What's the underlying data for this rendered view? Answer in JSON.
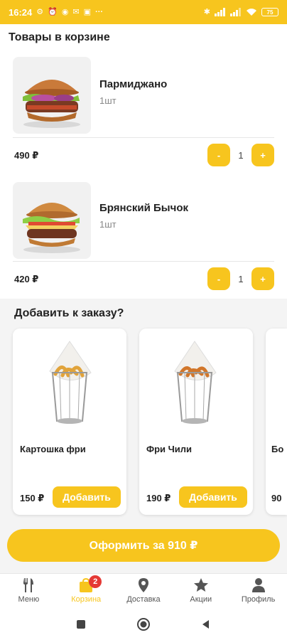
{
  "status_bar": {
    "time": "16:24",
    "battery": "75"
  },
  "cart": {
    "title": "Товары в корзине",
    "items": [
      {
        "name": "Пармиджано",
        "qty_text": "1шт",
        "price": "490 ₽",
        "qty": "1",
        "minus": "-",
        "plus": "+"
      },
      {
        "name": "Брянский Бычок",
        "qty_text": "1шт",
        "price": "420 ₽",
        "qty": "1",
        "minus": "-",
        "plus": "+"
      }
    ]
  },
  "upsell": {
    "title": "Добавить к заказу?",
    "items": [
      {
        "name": "Картошка фри",
        "price": "150 ₽",
        "button": "Добавить"
      },
      {
        "name": "Фри Чили",
        "price": "190 ₽",
        "button": "Добавить"
      },
      {
        "name": "Бо",
        "price": "90",
        "button": ""
      }
    ]
  },
  "checkout": {
    "label": "Оформить за 910 ₽"
  },
  "bottom_nav": {
    "items": [
      {
        "label": "Меню",
        "icon": "cutlery-icon"
      },
      {
        "label": "Корзина",
        "icon": "bag-icon",
        "badge": "2"
      },
      {
        "label": "Доставка",
        "icon": "location-pin-icon"
      },
      {
        "label": "Акции",
        "icon": "star-icon"
      },
      {
        "label": "Профиль",
        "icon": "person-icon"
      }
    ]
  },
  "colors": {
    "accent": "#f7c51e",
    "badge": "#e53935",
    "background": "#f4f4f4"
  }
}
